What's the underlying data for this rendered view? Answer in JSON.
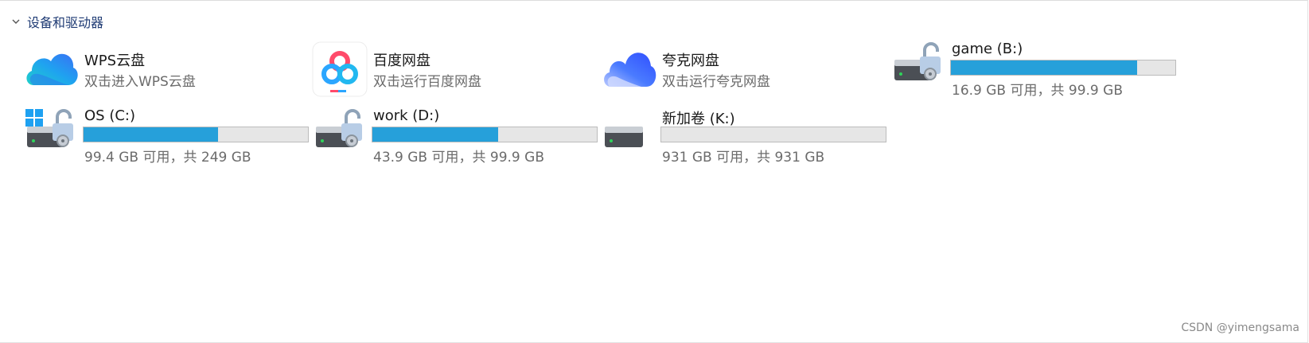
{
  "section": {
    "title": "设备和驱动器"
  },
  "cloud_items": [
    {
      "name": "WPS云盘",
      "subtitle": "双击进入WPS云盘",
      "icon": "wps-cloud-icon"
    },
    {
      "name": "百度网盘",
      "subtitle": "双击运行百度网盘",
      "icon": "baidu-netdisk-icon"
    },
    {
      "name": "夸克网盘",
      "subtitle": "双击运行夸克网盘",
      "icon": "quark-netdisk-icon"
    }
  ],
  "drives": [
    {
      "name": "game (B:)",
      "space": "16.9 GB 可用，共 99.9 GB",
      "used_fraction": 0.831,
      "icon": "locked-drive-icon"
    },
    {
      "name": "OS (C:)",
      "space": "99.4 GB 可用，共 249 GB",
      "used_fraction": 0.601,
      "icon": "windows-locked-drive-icon"
    },
    {
      "name": "work (D:)",
      "space": "43.9 GB 可用，共 99.9 GB",
      "used_fraction": 0.561,
      "icon": "locked-drive-icon"
    },
    {
      "name": "新加卷 (K:)",
      "space": "931 GB 可用，共 931 GB",
      "used_fraction": 0.0,
      "icon": "drive-icon"
    }
  ],
  "colors": {
    "bar_fill": "#26a0da",
    "bar_bg": "#e6e6e6",
    "header_text": "#1f3b74",
    "subtext": "#6b6b6b"
  },
  "watermark": "CSDN @yimengsama"
}
